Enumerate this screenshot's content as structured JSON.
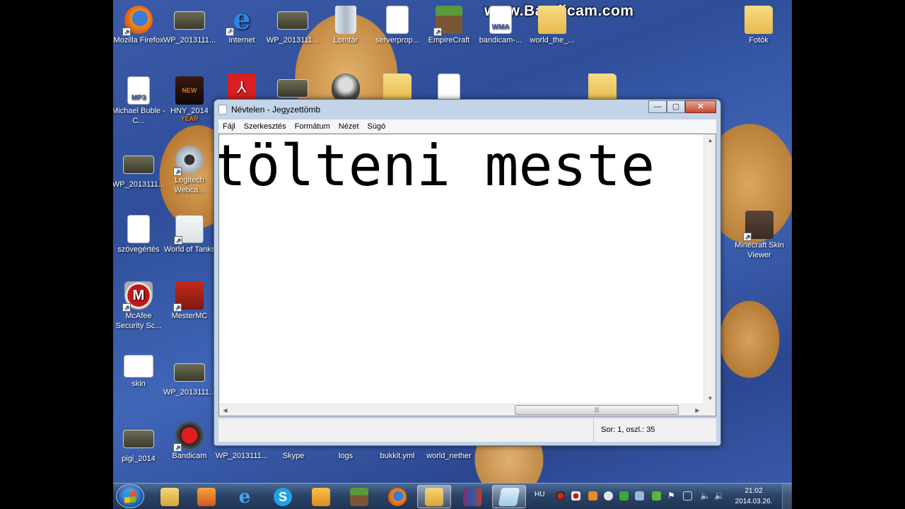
{
  "watermark": "www.Bandicam.com",
  "desktop_icons": [
    {
      "label": "Mozilla Firefox",
      "type": "ff",
      "shortcut": true
    },
    {
      "label": "WP_2013111...",
      "type": "photo"
    },
    {
      "label": "Internet",
      "type": "ie",
      "shortcut": true
    },
    {
      "label": "WP_2013111...",
      "type": "photo"
    },
    {
      "label": "Lomtár",
      "type": "bin"
    },
    {
      "label": "serverprop...",
      "type": "doc"
    },
    {
      "label": "EmpireCraft",
      "type": "grass",
      "shortcut": true
    },
    {
      "label": "bandicam-...",
      "type": "wma"
    },
    {
      "label": "world_the_...",
      "type": "folder"
    },
    {
      "label": "Fotók",
      "type": "folder"
    },
    {
      "label": "Michael Buble - C...",
      "type": "mp3"
    },
    {
      "label": "HNY_2014",
      "type": "hny"
    },
    {
      "label": "WP_2013111...",
      "type": "photo"
    },
    {
      "label": "Logitech Webca...",
      "type": "cam",
      "shortcut": true
    },
    {
      "label": "szövegértés",
      "type": "doc"
    },
    {
      "label": "World of Tanks",
      "type": "wot",
      "shortcut": true
    },
    {
      "label": "McAfee Security Sc...",
      "type": "mcafee",
      "shortcut": true
    },
    {
      "label": "MesterMC",
      "type": "mester",
      "shortcut": true
    },
    {
      "label": "skin",
      "type": "skin"
    },
    {
      "label": "WP_2013111...",
      "type": "photo"
    },
    {
      "label": "pigi_2014",
      "type": "photo"
    },
    {
      "label": "Bandicam",
      "type": "bandi",
      "shortcut": true
    },
    {
      "label": "WP_2013111...",
      "type": "photo"
    },
    {
      "label": "Skype",
      "type": "doc"
    },
    {
      "label": "logs",
      "type": "folder"
    },
    {
      "label": "bukkit.yml",
      "type": "doc"
    },
    {
      "label": "world_nether",
      "type": "folder"
    },
    {
      "label": "Minecraft Skin Viewer",
      "type": "mcskin",
      "shortcut": true
    }
  ],
  "notepad": {
    "title": "Névtelen - Jegyzettömb",
    "menu": [
      "Fájl",
      "Szerkesztés",
      "Formátum",
      "Nézet",
      "Súgó"
    ],
    "text": "tölteni meste",
    "status": "Sor: 1, oszl.: 35",
    "controls": {
      "minimize": "—",
      "maximize": "▢",
      "close": "✕"
    }
  },
  "taskbar": {
    "apps": [
      "file-explorer",
      "media-player",
      "internet-explorer",
      "skype",
      "outlook",
      "minecraft",
      "firefox",
      "bookmark-folder",
      "winrar",
      "notepad"
    ],
    "active_app": "notepad",
    "language": "HU",
    "time": "21:02",
    "date": "2014.03.26."
  }
}
